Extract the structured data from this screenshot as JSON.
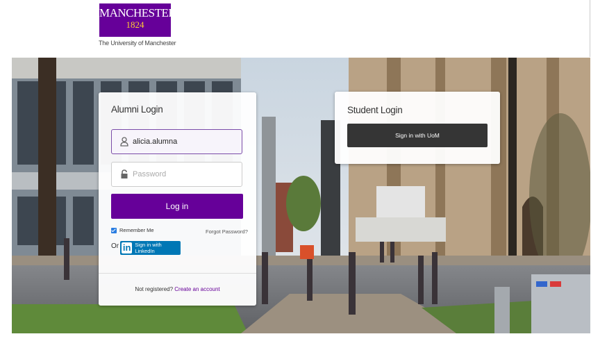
{
  "brand": {
    "logo_name": "MANCHESTER",
    "logo_year": "1824",
    "subtitle": "The University of Manchester",
    "colors": {
      "purple": "#660099",
      "gold": "#ffcc33"
    }
  },
  "alumni_login": {
    "title": "Alumni Login",
    "username_value": "alicia.alumna",
    "username_icon": "user-icon",
    "password_placeholder": "Password",
    "password_icon": "lock-icon",
    "login_button": "Log in",
    "remember_me": "Remember Me",
    "remember_checked": true,
    "forgot_password": "Forgot Password?",
    "or_label": "Or",
    "linkedin_logo": "in",
    "linkedin_button": "Sign in with LinkedIn",
    "not_registered": "Not registered?",
    "create_account": "Create an account"
  },
  "student_login": {
    "title": "Student Login",
    "sign_in_button": "Sign in with UoM"
  }
}
